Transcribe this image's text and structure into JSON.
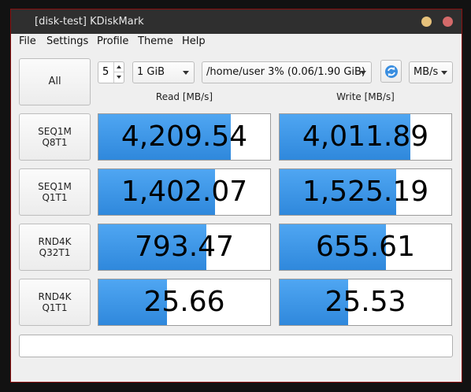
{
  "window": {
    "title": "[disk-test] KDiskMark"
  },
  "menu": [
    "File",
    "Settings",
    "Profile",
    "Theme",
    "Help"
  ],
  "controls": {
    "all_label": "All",
    "loops": "5",
    "size": "1 GiB",
    "target": "/home/user 3% (0.06/1.90 GiB)",
    "units": "MB/s"
  },
  "headers": {
    "read": "Read [MB/s]",
    "write": "Write [MB/s]"
  },
  "tests": [
    {
      "label": "SEQ1M\nQ8T1",
      "read": "4,209.54",
      "write": "4,011.89",
      "read_fill": 0.77,
      "write_fill": 0.76
    },
    {
      "label": "SEQ1M\nQ1T1",
      "read": "1,402.07",
      "write": "1,525.19",
      "read_fill": 0.68,
      "write_fill": 0.68
    },
    {
      "label": "RND4K\nQ32T1",
      "read": "793.47",
      "write": "655.61",
      "read_fill": 0.63,
      "write_fill": 0.62
    },
    {
      "label": "RND4K\nQ1T1",
      "read": "25.66",
      "write": "25.53",
      "read_fill": 0.4,
      "write_fill": 0.4
    }
  ],
  "status": "",
  "colors": {
    "accent": "#3a93e4",
    "titlebar": "#2f2f2f",
    "minimize": "#e6c17b",
    "close": "#d46a6a"
  }
}
